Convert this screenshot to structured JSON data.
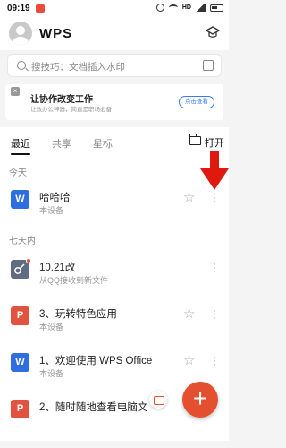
{
  "status_bar": {
    "time": "09:19",
    "hd_label": "HD"
  },
  "header": {
    "logo": "WPS"
  },
  "search": {
    "placeholder": "搜技巧：文档插入水印"
  },
  "banner": {
    "title": "让协作改变工作",
    "subtitle": "让效办公神器，简直是职场必备",
    "button": "点击查看",
    "close": "×"
  },
  "tabs": {
    "items": [
      "最近",
      "共享",
      "星标"
    ],
    "open": "打开"
  },
  "sections": {
    "today": "今天",
    "week": "七天内"
  },
  "files": [
    {
      "icon": "W",
      "name": "哈哈哈",
      "sub": "本设备"
    },
    {
      "icon": "",
      "name": "10.21改",
      "sub": "从QQ接收到新文件"
    },
    {
      "icon": "P",
      "name": "3、玩转特色应用",
      "sub": "本设备"
    },
    {
      "icon": "W",
      "name": "1、欢迎使用 WPS Office",
      "sub": "本设备"
    },
    {
      "icon": "P",
      "name": "2、随时随地查看电脑文",
      "sub": ""
    }
  ],
  "fab": {
    "label": "+"
  },
  "colors": {
    "accent": "#3a7bf5",
    "fab": "#e4502f",
    "word": "#2f6ee0",
    "ppt": "#e2533f",
    "arrow": "#e0190f"
  }
}
